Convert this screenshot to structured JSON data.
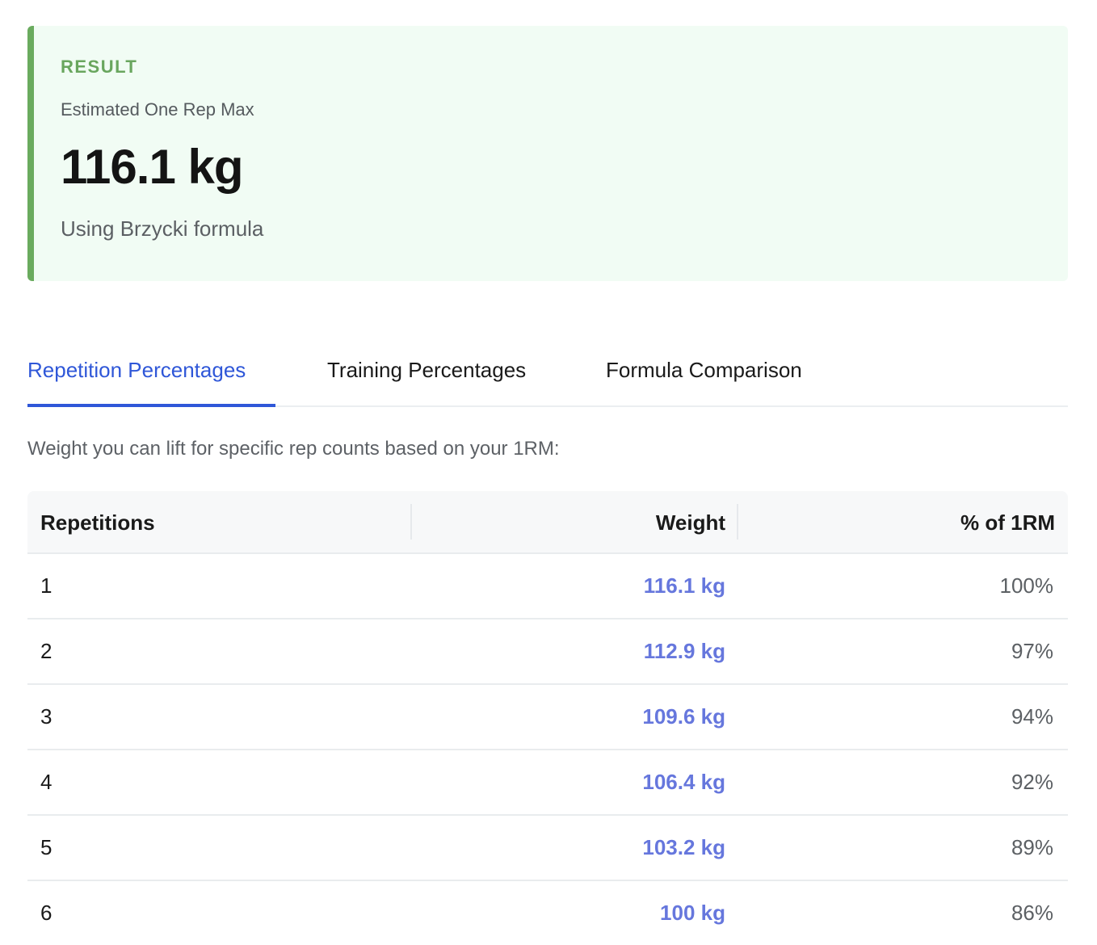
{
  "result": {
    "label": "RESULT",
    "subtitle": "Estimated One Rep Max",
    "value": "116.1 kg",
    "method": "Using Brzycki formula"
  },
  "tabs": [
    {
      "label": "Repetition Percentages",
      "active": true
    },
    {
      "label": "Training Percentages",
      "active": false
    },
    {
      "label": "Formula Comparison",
      "active": false
    }
  ],
  "description": "Weight you can lift for specific rep counts based on your 1RM:",
  "table": {
    "headers": {
      "repetitions": "Repetitions",
      "weight": "Weight",
      "percent": "% of 1RM"
    },
    "rows": [
      {
        "reps": "1",
        "weight": "116.1 kg",
        "percent": "100%"
      },
      {
        "reps": "2",
        "weight": "112.9 kg",
        "percent": "97%"
      },
      {
        "reps": "3",
        "weight": "109.6 kg",
        "percent": "94%"
      },
      {
        "reps": "4",
        "weight": "106.4 kg",
        "percent": "92%"
      },
      {
        "reps": "5",
        "weight": "103.2 kg",
        "percent": "89%"
      },
      {
        "reps": "6",
        "weight": "100 kg",
        "percent": "86%"
      }
    ]
  },
  "colors": {
    "accent_green": "#69a65e",
    "accent_blue": "#2f57d8",
    "weight_blue": "#6677dd",
    "result_bg": "#f1fcf4"
  }
}
